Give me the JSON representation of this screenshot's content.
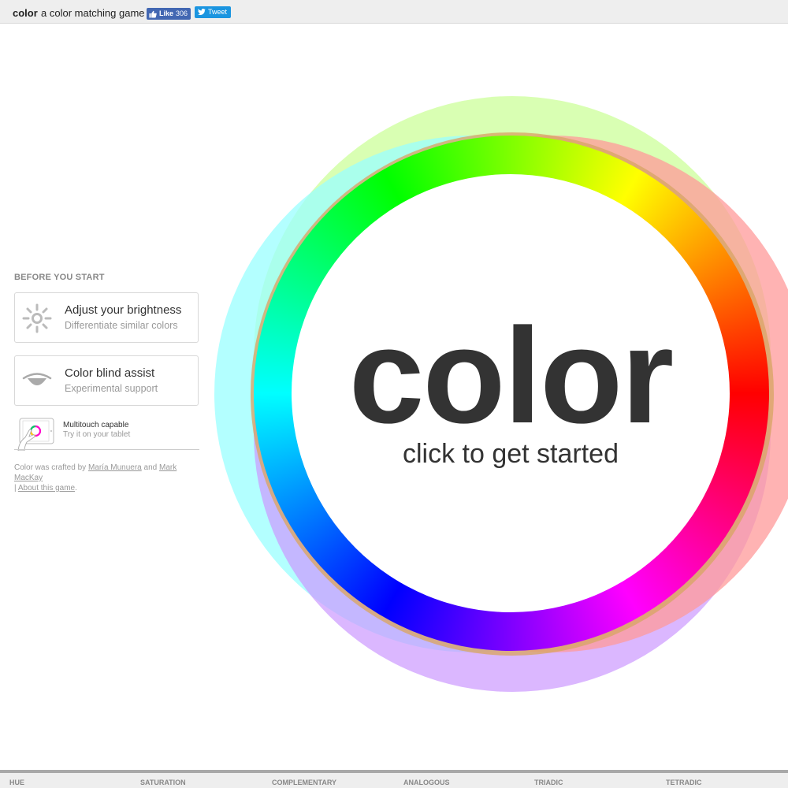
{
  "header": {
    "brand": "color",
    "tagline": "a color matching game",
    "like_label": "Like",
    "like_count": "306",
    "tweet_label": "Tweet"
  },
  "sidebar": {
    "section_title": "BEFORE YOU START",
    "cards": [
      {
        "title": "Adjust your brightness",
        "subtitle": "Differentiate similar colors",
        "icon": "sun-icon"
      },
      {
        "title": "Color blind assist",
        "subtitle": "Experimental support",
        "icon": "eye-icon"
      }
    ],
    "multitouch": {
      "title": "Multitouch capable",
      "subtitle": "Try it on your tablet",
      "icon": "tablet-hand-icon"
    },
    "credits": {
      "prefix": "Color was crafted by",
      "author1": "María Munuera",
      "and": "and",
      "author2": "Mark MacKay",
      "separator": "|",
      "about": "About this game",
      "suffix": "."
    }
  },
  "main": {
    "title": "color",
    "prompt": "click to get started"
  },
  "footer": {
    "tabs": [
      "HUE",
      "SATURATION",
      "COMPLEMENTARY",
      "ANALOGOUS",
      "TRIADIC",
      "TETRADIC"
    ]
  },
  "colors": {
    "topbar_bg": "#eeeeee",
    "facebook_blue": "#4267b2",
    "twitter_blue": "#1b95e0",
    "text_dark": "#333333",
    "text_muted": "#999999",
    "ring_green": "#ccff99",
    "ring_cyan": "#99ffff",
    "ring_violet": "#cc99ff",
    "ring_salmon": "#ff9999",
    "ring_orange": "#d9a566"
  }
}
